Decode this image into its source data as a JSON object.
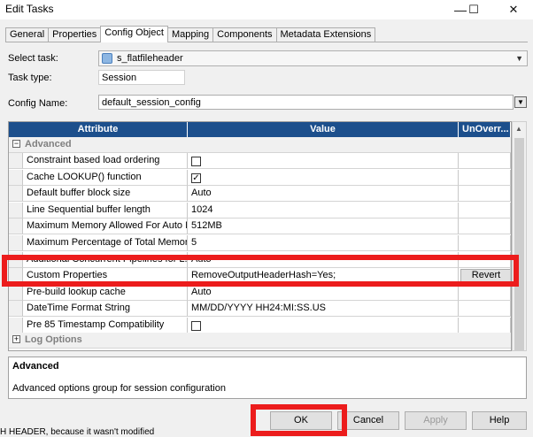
{
  "window": {
    "title": "Edit Tasks"
  },
  "title_controls": {
    "minimize": "—",
    "maximize": "☐",
    "close": "✕"
  },
  "tabs": [
    "General",
    "Properties",
    "Config Object",
    "Mapping",
    "Components",
    "Metadata Extensions"
  ],
  "active_tab": "Config Object",
  "form": {
    "select_task_label": "Select task:",
    "select_task_value": "s_flatfileheader",
    "task_type_label": "Task type:",
    "task_type_value": "Session",
    "config_name_label": "Config Name:",
    "config_name_value": "default_session_config"
  },
  "grid": {
    "headers": {
      "attribute": "Attribute",
      "value": "Value",
      "unoverride": "UnOverr..."
    },
    "group_advanced": "Advanced",
    "group_log": "Log Options",
    "rows": [
      {
        "attribute": "Constraint based load ordering",
        "value": "",
        "checkbox": true,
        "checked": false
      },
      {
        "attribute": "Cache LOOKUP() function",
        "value": "",
        "checkbox": true,
        "checked": true
      },
      {
        "attribute": "Default buffer block size",
        "value": "Auto"
      },
      {
        "attribute": "Line Sequential buffer length",
        "value": "1024"
      },
      {
        "attribute": "Maximum Memory Allowed For Auto M...",
        "value": "512MB"
      },
      {
        "attribute": "Maximum Percentage of Total Memory...",
        "value": "5"
      },
      {
        "attribute": "Additional Concurrent Pipelines for L...",
        "value": "Auto"
      },
      {
        "attribute": "Custom Properties",
        "value": "RemoveOutputHeaderHash=Yes;",
        "revert": "Revert"
      },
      {
        "attribute": "Pre-build lookup cache",
        "value": "Auto"
      },
      {
        "attribute": "DateTime Format String",
        "value": "MM/DD/YYYY HH24:MI:SS.US"
      },
      {
        "attribute": "Pre 85 Timestamp Compatibility",
        "value": "",
        "checkbox": true,
        "checked": false
      }
    ]
  },
  "description": {
    "title": "Advanced",
    "text": "Advanced options group for session configuration"
  },
  "buttons": {
    "ok": "OK",
    "cancel": "Cancel",
    "apply": "Apply",
    "help": "Help"
  },
  "status_line": "H HEADER, because it wasn't modified",
  "colors": {
    "header_bg": "#1c4f8c",
    "highlight": "#ec1c1c"
  }
}
